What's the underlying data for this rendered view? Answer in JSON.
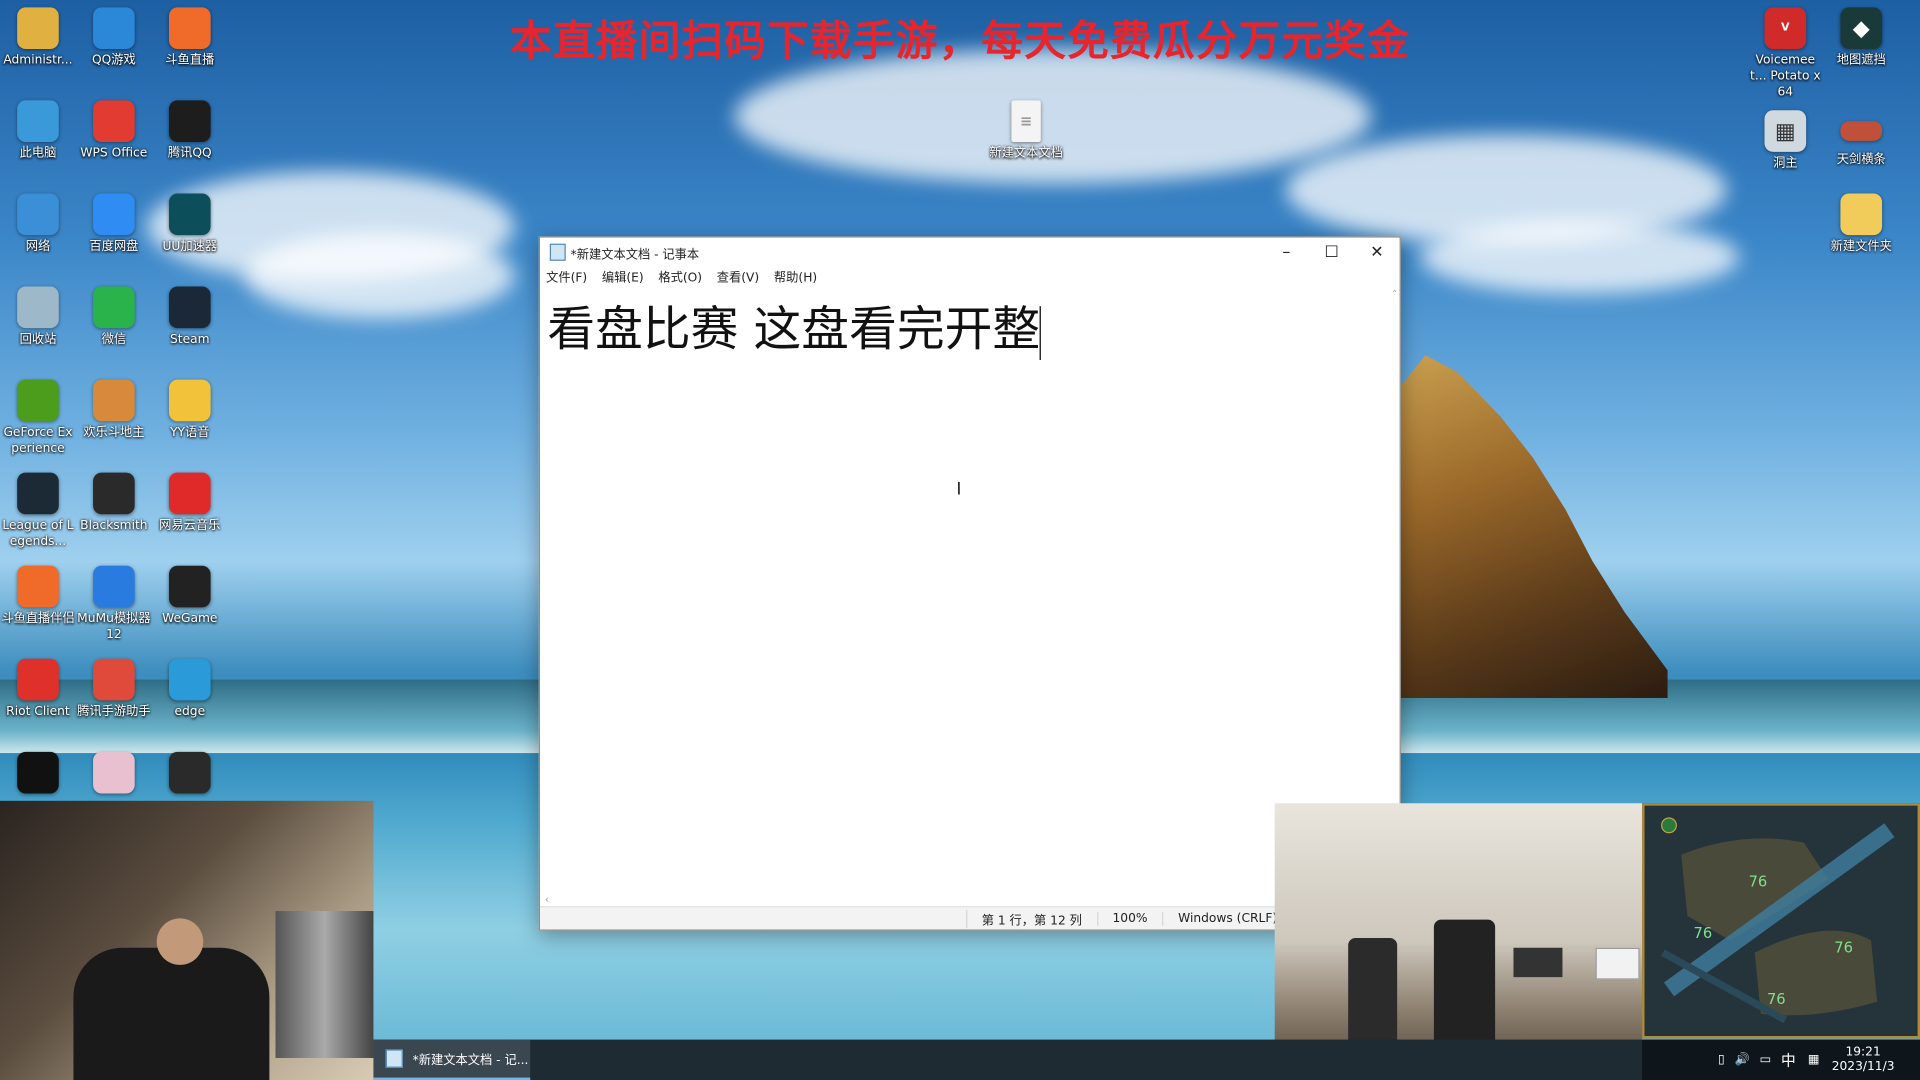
{
  "banner": {
    "text": "本直播间扫码下载手游，每天免费瓜分万元奖金"
  },
  "desktop_icons": [
    {
      "label": "Administr...",
      "icon": "user-folder-icon",
      "color": "#e0b040"
    },
    {
      "label": "QQ游戏",
      "icon": "qq-game-icon",
      "color": "#2b87d8"
    },
    {
      "label": "斗鱼直播",
      "icon": "douyu-icon",
      "color": "#f06b2a"
    },
    {
      "label": "此电脑",
      "icon": "computer-icon",
      "color": "#3a9ad9"
    },
    {
      "label": "WPS Office",
      "icon": "wps-icon",
      "color": "#e23b32"
    },
    {
      "label": "腾讯QQ",
      "icon": "qq-icon",
      "color": "#1d1d1d"
    },
    {
      "label": "网络",
      "icon": "network-icon",
      "color": "#3a8fd6"
    },
    {
      "label": "百度网盘",
      "icon": "baidu-netdisk-icon",
      "color": "#2f8cf2"
    },
    {
      "label": "UU加速器",
      "icon": "uu-icon",
      "color": "#0c4f5a"
    },
    {
      "label": "回收站",
      "icon": "recycle-bin-icon",
      "color": "#9db8c8"
    },
    {
      "label": "微信",
      "icon": "wechat-icon",
      "color": "#2ab34a"
    },
    {
      "label": "Steam",
      "icon": "steam-icon",
      "color": "#1b2838"
    },
    {
      "label": "GeForce Experience",
      "icon": "geforce-icon",
      "color": "#4d9d1d"
    },
    {
      "label": "欢乐斗地主",
      "icon": "doudizhu-icon",
      "color": "#d88a3a"
    },
    {
      "label": "YY语音",
      "icon": "yy-icon",
      "color": "#f2c33a"
    },
    {
      "label": "League of Legends...",
      "icon": "lol-icon",
      "color": "#1b2a35"
    },
    {
      "label": "Blacksmith",
      "icon": "blacksmith-icon",
      "color": "#2a2a2a"
    },
    {
      "label": "网易云音乐",
      "icon": "netease-music-icon",
      "color": "#e02a2a"
    },
    {
      "label": "斗鱼直播伴侣",
      "icon": "douyu-companion-icon",
      "color": "#f06b2a"
    },
    {
      "label": "MuMu模拟器12",
      "icon": "mumu-icon",
      "color": "#2a7be0"
    },
    {
      "label": "WeGame",
      "icon": "wegame-icon",
      "color": "#222222"
    },
    {
      "label": "Riot Client",
      "icon": "riot-icon",
      "color": "#e0302a"
    },
    {
      "label": "腾讯手游助手",
      "icon": "tencent-mobile-icon",
      "color": "#e04a3a"
    },
    {
      "label": "edge",
      "icon": "edge-icon",
      "color": "#2a9ad8"
    },
    {
      "label": "",
      "icon": "kk-icon",
      "color": "#111111"
    },
    {
      "label": "",
      "icon": "anime-app-icon",
      "color": "#e8c0d0"
    },
    {
      "label": "",
      "icon": "obs-icon",
      "color": "#2a2a2a"
    }
  ],
  "right_icons": [
    {
      "label": "Voicemeet... Potato x64",
      "icon": "voicemeeter-icon",
      "color": "#d02a2a"
    },
    {
      "label": "地图遮挡",
      "icon": "map-cover-icon",
      "color": "#1a3a3a"
    },
    {
      "label": "洞主",
      "icon": "dongzhu-icon",
      "color": "#d0d8e0"
    },
    {
      "label": "天剑横条",
      "icon": "tianjian-icon",
      "color": "#c0503a"
    },
    {
      "label": "新建文件夹",
      "icon": "folder-icon",
      "color": "#f2cc5a"
    }
  ],
  "center_icon": {
    "label": "新建文本文档",
    "icon": "text-document-icon"
  },
  "notepad": {
    "title": "*新建文本文档 - 记事本",
    "menu": [
      "文件(F)",
      "编辑(E)",
      "格式(O)",
      "查看(V)",
      "帮助(H)"
    ],
    "content": "看盘比赛 这盘看完开整",
    "status": {
      "position": "第 1 行，第 12 列",
      "zoom": "100%",
      "encoding": "Windows (CRLF)"
    }
  },
  "minimap": {
    "labels": [
      "76",
      "76",
      "76",
      "76"
    ]
  },
  "taskbar": {
    "item": "*新建文本文档 - 记..."
  },
  "tray": {
    "ime": "中",
    "time": "19:21",
    "date": "2023/11/3"
  }
}
